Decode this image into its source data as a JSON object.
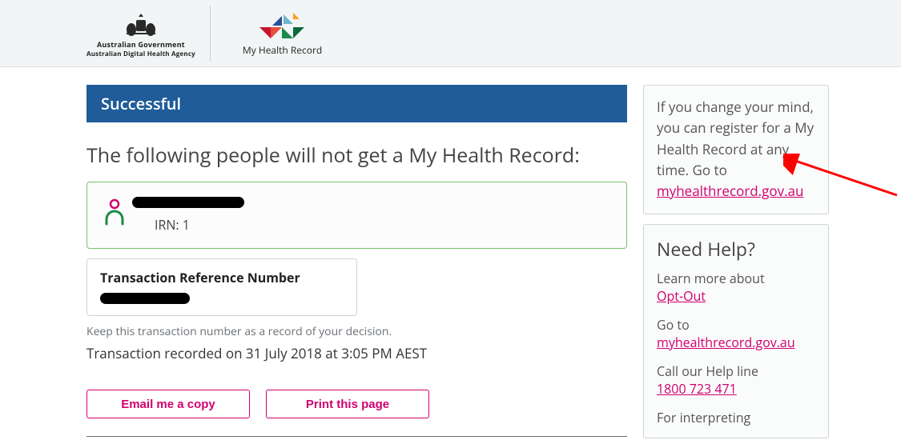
{
  "header": {
    "gov_line1": "Australian Government",
    "gov_line2": "Australian Digital Health Agency",
    "mhr_caption": "My Health Record"
  },
  "banner": {
    "title": "Successful"
  },
  "intro": "The following people will not get a My Health Record:",
  "person": {
    "irn_label": "IRN: 1"
  },
  "trn": {
    "title": "Transaction Reference Number"
  },
  "keep_note": "Keep this transaction number as a record of your decision.",
  "recorded": "Transaction recorded on 31 July 2018 at 3:05 PM AEST",
  "buttons": {
    "email": "Email me a copy",
    "print": "Print this page"
  },
  "side": {
    "change_mind_pre": "If you change your mind, you can register for a My Health Record at any time. Go to ",
    "change_mind_link": "myhealthrecord.gov.au",
    "help_title": "Need Help?",
    "learn_label": "Learn more about",
    "learn_link": "Opt-Out",
    "goto_label": "Go to",
    "goto_link": "myhealthrecord.gov.au",
    "call_label": "Call our Help line",
    "call_link": "1800 723 471",
    "interp_label": "For interpreting"
  }
}
